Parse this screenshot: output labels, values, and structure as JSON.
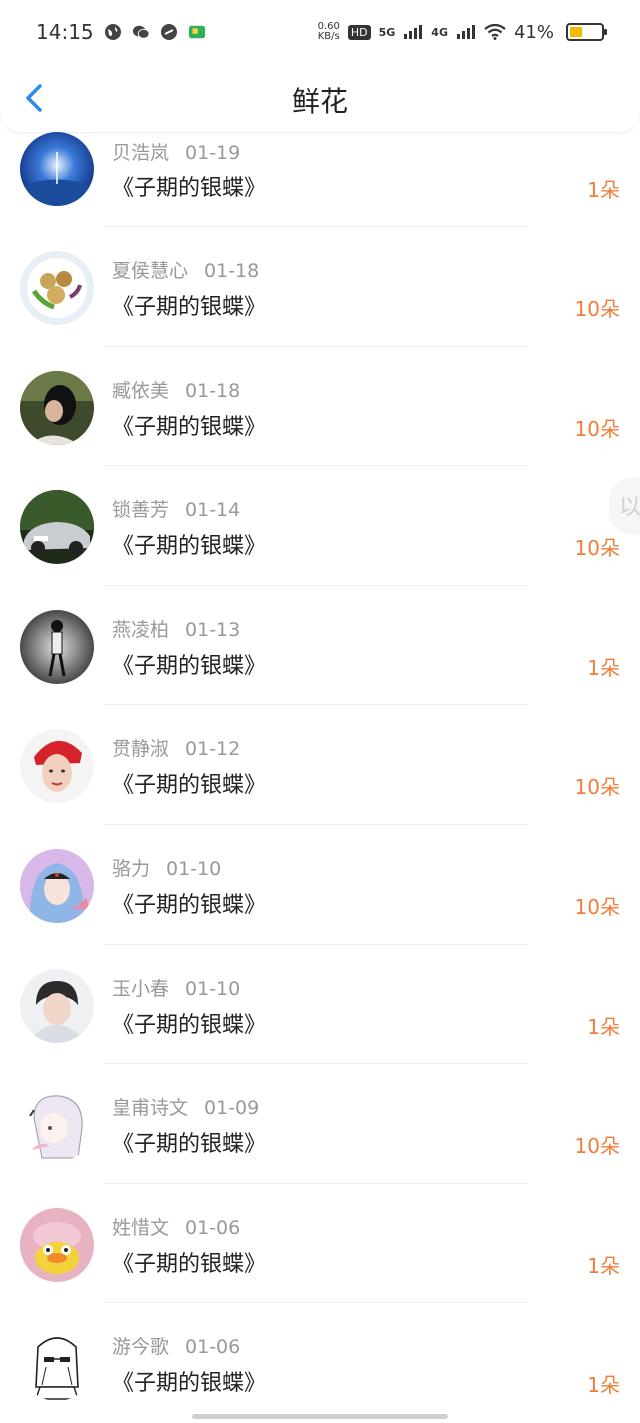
{
  "status_bar": {
    "time": "14:15",
    "net_speed_value": "0.60",
    "net_speed_unit": "KB/s",
    "hd_label": "HD",
    "sig1_label": "5G",
    "sig2_label": "4G",
    "battery_percent_text": "41%",
    "battery_level": 0.41,
    "battery_color": "#f5b800"
  },
  "header": {
    "title": "鲜花",
    "back_icon": "chevron-left-icon",
    "accent_color": "#2b8cf0"
  },
  "side_handle": {
    "glyph": "以"
  },
  "list": {
    "count_color": "#f07d3a",
    "items": [
      {
        "user": "贝浩岚",
        "date": "01-19",
        "book": "《子期的银蝶》",
        "count": "1朵"
      },
      {
        "user": "夏侯慧心",
        "date": "01-18",
        "book": "《子期的银蝶》",
        "count": "10朵"
      },
      {
        "user": "臧依美",
        "date": "01-18",
        "book": "《子期的银蝶》",
        "count": "10朵"
      },
      {
        "user": "锁善芳",
        "date": "01-14",
        "book": "《子期的银蝶》",
        "count": "10朵"
      },
      {
        "user": "燕凌柏",
        "date": "01-13",
        "book": "《子期的银蝶》",
        "count": "1朵"
      },
      {
        "user": "贯静淑",
        "date": "01-12",
        "book": "《子期的银蝶》",
        "count": "10朵"
      },
      {
        "user": "骆力",
        "date": "01-10",
        "book": "《子期的银蝶》",
        "count": "10朵"
      },
      {
        "user": "玉小春",
        "date": "01-10",
        "book": "《子期的银蝶》",
        "count": "1朵"
      },
      {
        "user": "皇甫诗文",
        "date": "01-09",
        "book": "《子期的银蝶》",
        "count": "10朵"
      },
      {
        "user": "姓惜文",
        "date": "01-06",
        "book": "《子期的银蝶》",
        "count": "1朵"
      },
      {
        "user": "游今歌",
        "date": "01-06",
        "book": "《子期的银蝶》",
        "count": "1朵"
      }
    ]
  }
}
